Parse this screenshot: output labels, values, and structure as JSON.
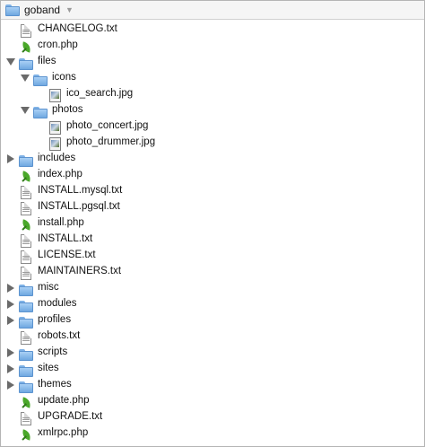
{
  "window": {
    "title": "goband"
  },
  "tree": [
    {
      "label": "CHANGELOG.txt",
      "type": "doc",
      "depth": 0
    },
    {
      "label": "cron.php",
      "type": "php",
      "depth": 0
    },
    {
      "label": "files",
      "type": "folder",
      "depth": 0,
      "expanded": true
    },
    {
      "label": "icons",
      "type": "folder",
      "depth": 1,
      "expanded": true
    },
    {
      "label": "ico_search.jpg",
      "type": "image",
      "depth": 2
    },
    {
      "label": "photos",
      "type": "folder",
      "depth": 1,
      "expanded": true
    },
    {
      "label": "photo_concert.jpg",
      "type": "image",
      "depth": 2
    },
    {
      "label": "photo_drummer.jpg",
      "type": "image",
      "depth": 2
    },
    {
      "label": "includes",
      "type": "folder",
      "depth": 0,
      "expanded": false
    },
    {
      "label": "index.php",
      "type": "php",
      "depth": 0
    },
    {
      "label": "INSTALL.mysql.txt",
      "type": "doc",
      "depth": 0
    },
    {
      "label": "INSTALL.pgsql.txt",
      "type": "doc",
      "depth": 0
    },
    {
      "label": "install.php",
      "type": "php",
      "depth": 0
    },
    {
      "label": "INSTALL.txt",
      "type": "doc",
      "depth": 0
    },
    {
      "label": "LICENSE.txt",
      "type": "doc",
      "depth": 0
    },
    {
      "label": "MAINTAINERS.txt",
      "type": "doc",
      "depth": 0
    },
    {
      "label": "misc",
      "type": "folder",
      "depth": 0,
      "expanded": false
    },
    {
      "label": "modules",
      "type": "folder",
      "depth": 0,
      "expanded": false
    },
    {
      "label": "profiles",
      "type": "folder",
      "depth": 0,
      "expanded": false
    },
    {
      "label": "robots.txt",
      "type": "doc",
      "depth": 0
    },
    {
      "label": "scripts",
      "type": "folder",
      "depth": 0,
      "expanded": false
    },
    {
      "label": "sites",
      "type": "folder",
      "depth": 0,
      "expanded": false
    },
    {
      "label": "themes",
      "type": "folder",
      "depth": 0,
      "expanded": false
    },
    {
      "label": "update.php",
      "type": "php",
      "depth": 0
    },
    {
      "label": "UPGRADE.txt",
      "type": "doc",
      "depth": 0
    },
    {
      "label": "xmlrpc.php",
      "type": "php",
      "depth": 0
    }
  ],
  "icons": {
    "folder": "folder-icon",
    "doc": "text-file-icon",
    "php": "php-file-icon",
    "image": "image-file-icon",
    "expanded": "disclosure-open-icon",
    "collapsed": "disclosure-closed-icon",
    "title_dropdown": "chevron-down-icon"
  },
  "colors": {
    "folder": "#6fa8e0",
    "php_leaf": "#4aa82a",
    "disclosure": "#6a6a6a"
  }
}
